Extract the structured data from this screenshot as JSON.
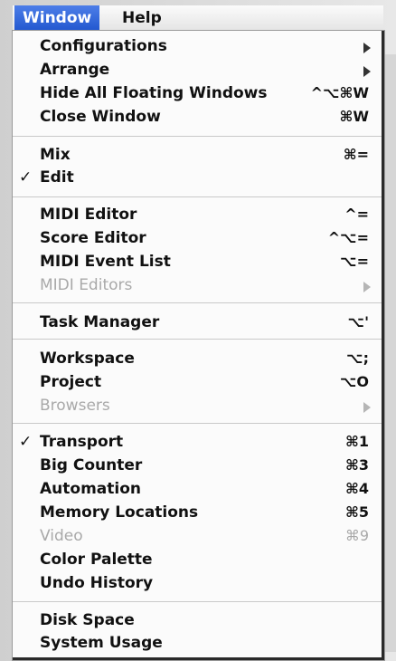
{
  "menubar": {
    "window_label": "Window",
    "help_label": "Help"
  },
  "menu": {
    "configurations": {
      "label": "Configurations"
    },
    "arrange": {
      "label": "Arrange"
    },
    "hide_floating": {
      "label": "Hide All Floating Windows",
      "shortcut": "^⌥⌘W"
    },
    "close_window": {
      "label": "Close Window",
      "shortcut": "⌘W"
    },
    "mix": {
      "label": "Mix",
      "shortcut": "⌘="
    },
    "edit": {
      "label": "Edit",
      "check": "✓"
    },
    "midi_editor": {
      "label": "MIDI Editor",
      "shortcut": "^="
    },
    "score_editor": {
      "label": "Score Editor",
      "shortcut": "^⌥="
    },
    "midi_event_list": {
      "label": "MIDI Event List",
      "shortcut": "⌥="
    },
    "midi_editors": {
      "label": "MIDI Editors"
    },
    "task_manager": {
      "label": "Task Manager",
      "shortcut": "⌥'"
    },
    "workspace": {
      "label": "Workspace",
      "shortcut": "⌥;"
    },
    "project": {
      "label": "Project",
      "shortcut": "⌥O"
    },
    "browsers": {
      "label": "Browsers"
    },
    "transport": {
      "label": "Transport",
      "check": "✓",
      "shortcut": "⌘1"
    },
    "big_counter": {
      "label": "Big Counter",
      "shortcut": "⌘3"
    },
    "automation": {
      "label": "Automation",
      "shortcut": "⌘4"
    },
    "memory_locations": {
      "label": "Memory Locations",
      "shortcut": "⌘5"
    },
    "video": {
      "label": "Video",
      "shortcut": "⌘9"
    },
    "color_palette": {
      "label": "Color Palette"
    },
    "undo_history": {
      "label": "Undo History"
    },
    "disk_space": {
      "label": "Disk Space"
    },
    "system_usage": {
      "label": "System Usage"
    }
  }
}
